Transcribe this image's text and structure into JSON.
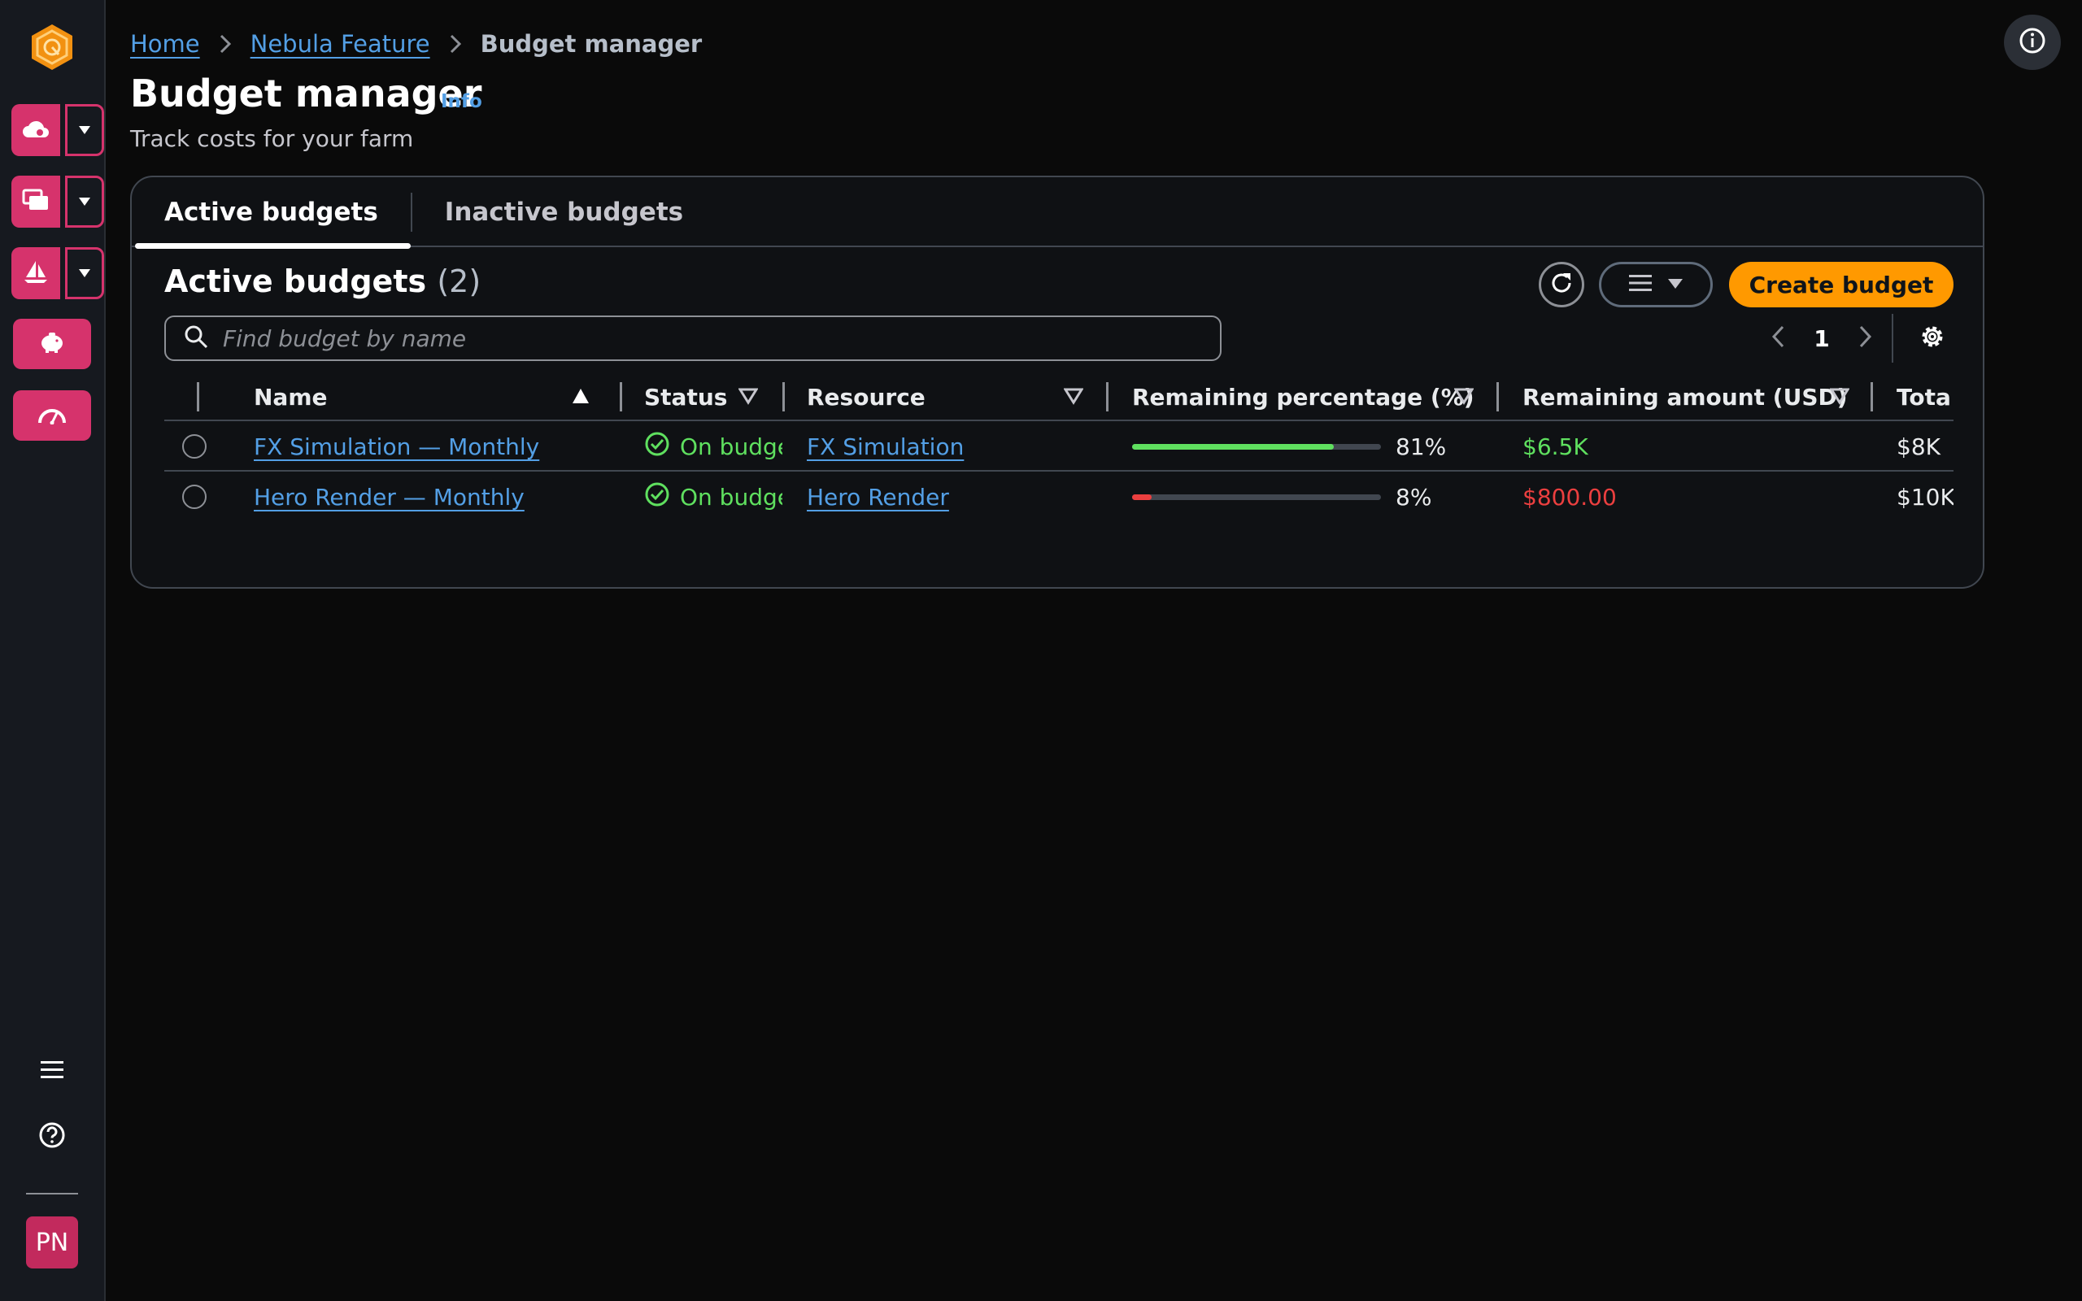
{
  "breadcrumb": {
    "home": "Home",
    "feature": "Nebula Feature",
    "current": "Budget manager"
  },
  "header": {
    "title": "Budget manager",
    "info": "Info",
    "subtitle": "Track costs for your farm"
  },
  "tabs": [
    {
      "label": "Active budgets",
      "active": true
    },
    {
      "label": "Inactive budgets",
      "active": false
    }
  ],
  "table": {
    "title": "Active budgets",
    "count": "(2)",
    "create_label": "Create budget",
    "search_placeholder": "Find budget by name",
    "page": "1",
    "columns": {
      "name": "Name",
      "status": "Status",
      "resource": "Resource",
      "remaining_pct": "Remaining percentage (%)",
      "remaining_amt": "Remaining amount (USD)",
      "total": "Tota"
    },
    "rows": [
      {
        "name": "FX Simulation — Monthly",
        "status": "On budge",
        "resource": "FX Simulation",
        "remaining_pct": 81,
        "remaining_pct_label": "81%",
        "remaining_amt": "$6.5K",
        "total": "$8K"
      },
      {
        "name": "Hero Render — Monthly",
        "status": "On budge",
        "resource": "Hero Render",
        "remaining_pct": 8,
        "remaining_pct_label": "8%",
        "remaining_amt": "$800.00",
        "total": "$10K"
      }
    ]
  },
  "user": {
    "initials": "PN"
  },
  "colors": {
    "accent": "#ff9900",
    "rail_button": "#d6336c",
    "link": "#539fe5",
    "ok": "#5fe05f",
    "danger": "#eb3f3f"
  },
  "icons": [
    "app-logo-icon",
    "cloud-icon",
    "windows-icon",
    "sailboat-icon",
    "piggy-bank-icon",
    "gauge-icon",
    "menu-icon",
    "help-icon",
    "info-icon",
    "chevron-right-icon",
    "refresh-icon",
    "list-icon",
    "caret-down-icon",
    "search-icon",
    "chevron-left-icon",
    "gear-icon",
    "sort-ascending-icon",
    "filter-icon",
    "check-circle-icon"
  ]
}
